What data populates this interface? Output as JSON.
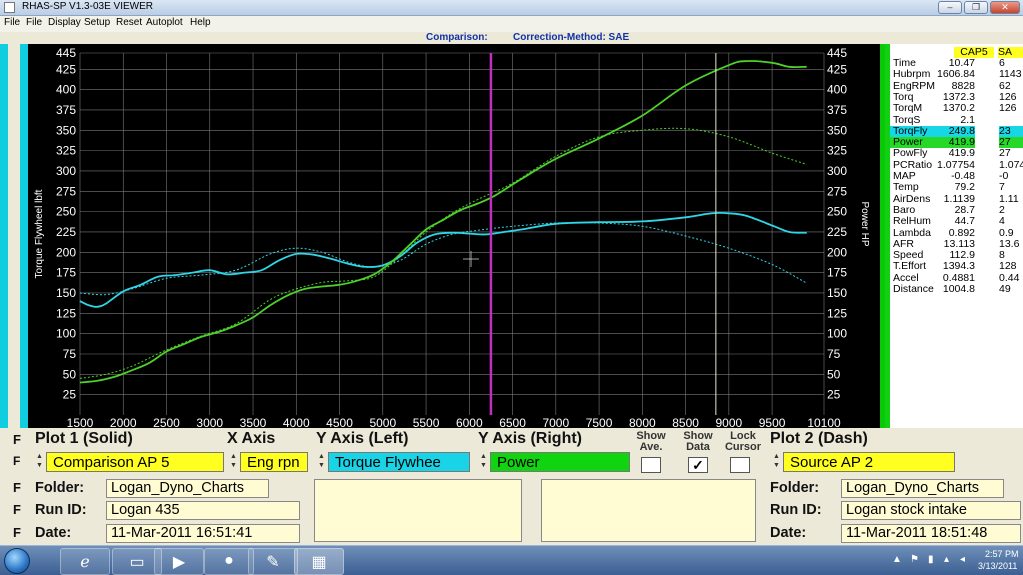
{
  "window": {
    "title": "RHAS-SP V1.3-03E VIEWER",
    "min_label": "–",
    "max_label": "❐",
    "close_label": "✕"
  },
  "menu": [
    "File",
    "Display",
    "Setup",
    "Reset",
    "Autoplot",
    "Help"
  ],
  "header": {
    "comparison_label": "Comparison:",
    "correction_label": "Correction-Method: SAE"
  },
  "chart_data": {
    "type": "line",
    "x_ticks": [
      "1500",
      "2000",
      "2500",
      "3000",
      "3500",
      "4000",
      "4500",
      "5000",
      "5500",
      "6000",
      "6500",
      "7000",
      "7500",
      "8000",
      "8500",
      "9000",
      "9500",
      "10100"
    ],
    "y_ticks": [
      "25",
      "50",
      "75",
      "100",
      "125",
      "150",
      "175",
      "200",
      "225",
      "250",
      "275",
      "300",
      "325",
      "350",
      "375",
      "400",
      "425",
      "445"
    ],
    "ylabel_left": "Torque Flywheel lbft",
    "ylabel_right": "Power HP",
    "xlim": [
      1500,
      10100
    ],
    "ylim": [
      0,
      445
    ],
    "cursor_x": 6250,
    "lock_cursor_x": 8850,
    "colors": {
      "torque": "#2fd6e6",
      "power": "#4ed12a",
      "cursor": "#c030c0",
      "grid": "#7a7a7a"
    },
    "series": [
      {
        "name": "Torque Flywheel",
        "style": "solid",
        "color": "#2fd6e6",
        "x": [
          1500,
          1600,
          1700,
          1800,
          2000,
          2200,
          2400,
          2600,
          2800,
          3000,
          3200,
          3400,
          3600,
          3800,
          4000,
          4200,
          4400,
          4600,
          4800,
          5000,
          5200,
          5400,
          5600,
          5800,
          6000,
          6200,
          6400,
          6600,
          7000,
          7500,
          8000,
          8500,
          8800,
          9000,
          9200,
          9500,
          9700,
          9900
        ],
        "y": [
          140,
          135,
          133,
          137,
          152,
          160,
          170,
          172,
          175,
          178,
          173,
          175,
          178,
          190,
          198,
          197,
          192,
          186,
          182,
          184,
          195,
          212,
          222,
          224,
          223,
          222,
          225,
          228,
          235,
          237,
          238,
          243,
          248,
          248,
          245,
          233,
          225,
          224
        ]
      },
      {
        "name": "Power",
        "style": "solid",
        "color": "#4ed12a",
        "x": [
          1500,
          1700,
          1900,
          2100,
          2300,
          2500,
          2700,
          2900,
          3100,
          3300,
          3500,
          3700,
          3900,
          4100,
          4300,
          4500,
          4700,
          4900,
          5100,
          5300,
          5500,
          5700,
          5900,
          6100,
          6300,
          6600,
          7000,
          7500,
          8000,
          8500,
          9000,
          9200,
          9500,
          9700,
          9900
        ],
        "y": [
          40,
          42,
          47,
          55,
          64,
          78,
          87,
          96,
          102,
          110,
          120,
          135,
          147,
          155,
          158,
          160,
          165,
          173,
          188,
          208,
          228,
          240,
          252,
          260,
          270,
          290,
          315,
          340,
          368,
          405,
          430,
          435,
          433,
          428,
          428
        ]
      },
      {
        "name": "Torque Flywheel (Source)",
        "style": "dash",
        "color": "#2fd6e6",
        "x": [
          1500,
          1800,
          2100,
          2500,
          2900,
          3300,
          3700,
          4000,
          4300,
          4600,
          4900,
          5200,
          5500,
          5800,
          6100,
          6500,
          7000,
          7500,
          8000,
          8500,
          9000,
          9500,
          9900
        ],
        "y": [
          150,
          148,
          155,
          168,
          172,
          178,
          198,
          205,
          200,
          188,
          182,
          190,
          210,
          222,
          227,
          232,
          236,
          236,
          232,
          220,
          205,
          185,
          162
        ]
      },
      {
        "name": "Power (Source)",
        "style": "dash",
        "color": "#4ed12a",
        "x": [
          1500,
          1800,
          2100,
          2500,
          2900,
          3300,
          3700,
          4000,
          4300,
          4600,
          4900,
          5200,
          5500,
          5800,
          6100,
          6500,
          7000,
          7500,
          8000,
          8500,
          9000,
          9500,
          9900
        ],
        "y": [
          45,
          50,
          60,
          80,
          97,
          112,
          142,
          155,
          163,
          165,
          170,
          195,
          225,
          248,
          265,
          285,
          318,
          342,
          350,
          352,
          342,
          322,
          308
        ]
      }
    ]
  },
  "data_table": {
    "col1_header": "CAP5",
    "col2_header": "SA",
    "rows": [
      {
        "label": "Time",
        "v1": "10.47",
        "v2": "6"
      },
      {
        "label": "Hubrpm",
        "v1": "1606.84",
        "v2": "1143"
      },
      {
        "label": "EngRPM",
        "v1": "8828",
        "v2": "62"
      },
      {
        "label": "Torq",
        "v1": "1372.3",
        "v2": "126"
      },
      {
        "label": "TorqM",
        "v1": "1370.2",
        "v2": "126"
      },
      {
        "label": "TorqS",
        "v1": "2.1",
        "v2": ""
      },
      {
        "label": "TorqFly",
        "v1": "249.8",
        "v2": "23",
        "highlight": "#17d6e6"
      },
      {
        "label": "Power",
        "v1": "419.9",
        "v2": "27",
        "highlight": "#28d828"
      },
      {
        "label": "PowFly",
        "v1": "419.9",
        "v2": "27"
      },
      {
        "label": "PCRatio",
        "v1": "1.07754",
        "v2": "1.074"
      },
      {
        "label": "MAP",
        "v1": "-0.48",
        "v2": "-0"
      },
      {
        "label": "Temp",
        "v1": "79.2",
        "v2": "7"
      },
      {
        "label": "AirDens",
        "v1": "1.1139",
        "v2": "1.11"
      },
      {
        "label": "Baro",
        "v1": "28.7",
        "v2": "2"
      },
      {
        "label": "RelHum",
        "v1": "44.7",
        "v2": "4"
      },
      {
        "label": "Lambda",
        "v1": "0.892",
        "v2": "0.9"
      },
      {
        "label": "AFR",
        "v1": "13.113",
        "v2": "13.6"
      },
      {
        "label": "Speed",
        "v1": "112.9",
        "v2": "8"
      },
      {
        "label": "T.Effort",
        "v1": "1394.3",
        "v2": "128"
      },
      {
        "label": "Accel",
        "v1": "0.4881",
        "v2": "0.44"
      },
      {
        "label": "Distance",
        "v1": "1004.8",
        "v2": "49"
      }
    ]
  },
  "controls": {
    "plot1_label": "Plot 1 (Solid)",
    "xaxis_label": "X Axis",
    "yleft_label": "Y Axis (Left)",
    "yright_label": "Y Axis (Right)",
    "show_ave_label": "Show Ave.",
    "show_data_label": "Show Data",
    "lock_cursor_label": "Lock Cursor",
    "plot2_label": "Plot 2 (Dash)",
    "plot1_value": "Comparison AP 5",
    "xaxis_value": "Eng rpn",
    "yleft_value": "Torque Flywhee",
    "yright_value": "Power",
    "plot2_value": "Source AP 2",
    "show_ave_checked": "",
    "show_data_checked": "✓",
    "lock_cursor_checked": "",
    "folder_label": "Folder:",
    "runid_label": "Run ID:",
    "date_label": "Date:",
    "f_label": "F",
    "r_label": "F",
    "d_label": "F",
    "p_label": "F",
    "left_folder": "Logan_Dyno_Charts",
    "left_runid": "Logan 435",
    "left_date": "11-Mar-2011  16:51:41",
    "right_folder": "Logan_Dyno_Charts",
    "right_runid": "Logan stock intake",
    "right_date": "11-Mar-2011  18:51:48"
  },
  "taskbar": {
    "time": "2:57 PM",
    "date": "3/13/2011"
  }
}
